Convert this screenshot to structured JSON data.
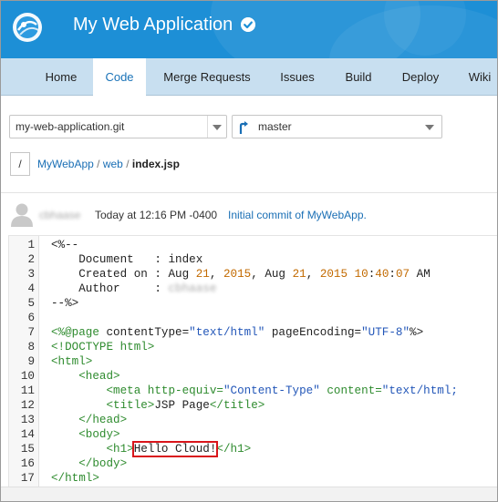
{
  "header": {
    "app_title": "My Web Application",
    "brand_color": "#1d8fd6"
  },
  "tabs": [
    {
      "label": "Home",
      "active": false
    },
    {
      "label": "Code",
      "active": true
    },
    {
      "label": "Merge Requests",
      "active": false
    },
    {
      "label": "Issues",
      "active": false
    },
    {
      "label": "Build",
      "active": false
    },
    {
      "label": "Deploy",
      "active": false
    },
    {
      "label": "Wiki",
      "active": false
    }
  ],
  "repo_select": {
    "value": "my-web-application.git"
  },
  "branch_select": {
    "value": "master"
  },
  "breadcrumb": {
    "root": "/",
    "parts": [
      "MyWebApp",
      "/",
      "web",
      "/"
    ],
    "current": "index.jsp"
  },
  "commit": {
    "author": "cbhaase",
    "time": "Today at 12:16 PM -0400",
    "message": "Initial commit of MyWebApp."
  },
  "code": {
    "line_numbers": [
      "1",
      "2",
      "3",
      "4",
      "5",
      "6",
      "7",
      "8",
      "9",
      "10",
      "11",
      "12",
      "13",
      "14",
      "15",
      "16",
      "17"
    ],
    "lines": {
      "l1": "<%--",
      "l2": "    Document   : index",
      "l3_a": "    Created on : Aug ",
      "l3_b": "21",
      "l3_c": ", ",
      "l3_d": "2015",
      "l3_e": ", Aug ",
      "l3_f": "21",
      "l3_g": ", ",
      "l3_h": "2015",
      "l3_i": " ",
      "l3_j": "10",
      "l3_k": ":",
      "l3_l": "40",
      "l3_m": ":",
      "l3_n": "07",
      "l3_o": " AM",
      "l4_a": "    Author     : ",
      "l4_b": "cbhaase",
      "l5": "--%>",
      "l7_a": "<%@page",
      "l7_b": " contentType=",
      "l7_c": "\"text/html\"",
      "l7_d": " pageEncoding=",
      "l7_e": "\"UTF-8\"",
      "l7_f": "%>",
      "l8": "<!DOCTYPE html>",
      "l9": "<html>",
      "l10": "    <head>",
      "l11_a": "        <meta",
      "l11_b": " http-equiv=",
      "l11_c": "\"Content-Type\"",
      "l11_d": " content=",
      "l11_e": "\"text/html;",
      "l12_a": "        <title>",
      "l12_b": "JSP Page",
      "l12_c": "</title>",
      "l13": "    </head>",
      "l14": "    <body>",
      "l15_a": "        <h1>",
      "l15_b": "Hello Cloud!",
      "l15_c": "</h1>",
      "l16": "    </body>",
      "l17": "</html>"
    },
    "highlight_color": "#d9151b"
  }
}
